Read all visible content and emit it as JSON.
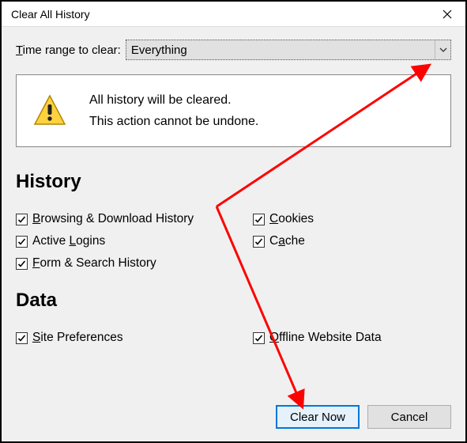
{
  "title": "Clear All History",
  "timerange": {
    "label_pre_ul": "T",
    "label_post": "ime range to clear:",
    "value": "Everything"
  },
  "warning": {
    "line1": "All history will be cleared.",
    "line2": "This action cannot be undone."
  },
  "sections": {
    "history_heading": "History",
    "data_heading": "Data"
  },
  "checks": {
    "browsing": {
      "ul": "B",
      "rest": "rowsing & Download History",
      "checked": true
    },
    "cookies": {
      "ul": "C",
      "rest": "ookies",
      "checked": true
    },
    "logins": {
      "pre": "Active ",
      "ul": "L",
      "rest": "ogins",
      "checked": true
    },
    "cache": {
      "pre": "C",
      "ul": "a",
      "rest": "che",
      "checked": true
    },
    "form": {
      "ul": "F",
      "rest": "orm & Search History",
      "checked": true
    },
    "siteprefs": {
      "ul": "S",
      "rest": "ite Preferences",
      "checked": true
    },
    "offline": {
      "ul": "O",
      "rest": "ffline Website Data",
      "checked": true
    }
  },
  "buttons": {
    "clear": "Clear Now",
    "cancel": "Cancel"
  },
  "colors": {
    "arrow": "#ff0000",
    "primary_border": "#0078d7"
  }
}
